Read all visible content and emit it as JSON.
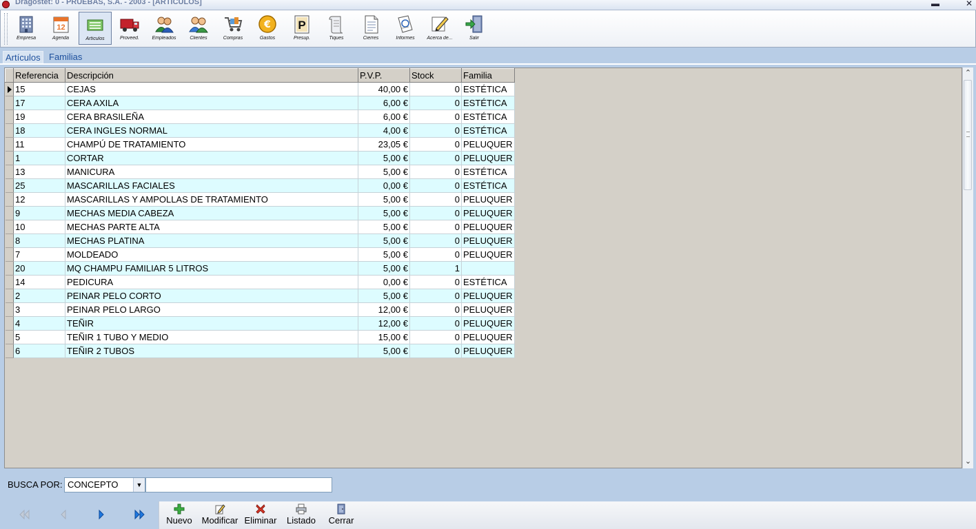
{
  "window": {
    "title": "Dragostet: 0 - PRUEBAS, S.A. - 2003 - [ARTICULOS]",
    "minimize_glyph": "▬",
    "close_glyph": "✕"
  },
  "toolbar": {
    "buttons": [
      {
        "label": "Empresa",
        "icon": "building-icon"
      },
      {
        "label": "Agenda",
        "icon": "calendar-icon",
        "calendar_day": "12"
      },
      {
        "label": "Artículos",
        "icon": "articles-icon",
        "active": true
      },
      {
        "label": "Proveed.",
        "icon": "truck-icon"
      },
      {
        "label": "Empleados",
        "icon": "employees-icon"
      },
      {
        "label": "Clientes",
        "icon": "clients-icon"
      },
      {
        "label": "Compras",
        "icon": "cart-icon"
      },
      {
        "label": "Gastos",
        "icon": "euro-coin-icon",
        "coin_glyph": "€"
      },
      {
        "label": "Presup.",
        "icon": "budget-icon",
        "badge_glyph": "P"
      },
      {
        "label": "Tiques",
        "icon": "receipt-icon"
      },
      {
        "label": "Cierres",
        "icon": "document-icon"
      },
      {
        "label": "Informes",
        "icon": "report-icon"
      },
      {
        "label": "Acerca de...",
        "icon": "pen-icon"
      },
      {
        "label": "Salir",
        "icon": "exit-door-icon"
      }
    ]
  },
  "tabs": [
    {
      "label": "Artículos",
      "active": true
    },
    {
      "label": "Familias",
      "active": false
    }
  ],
  "grid": {
    "columns": [
      "Referencia",
      "Descripción",
      "P.V.P.",
      "Stock",
      "Familia"
    ],
    "selected_row": 0,
    "rows": [
      {
        "ref": "15",
        "desc": "CEJAS",
        "pvp": "40,00 €",
        "stock": "0",
        "familia": "ESTÉTICA"
      },
      {
        "ref": "17",
        "desc": "CERA AXILA",
        "pvp": "6,00 €",
        "stock": "0",
        "familia": "ESTÉTICA"
      },
      {
        "ref": "19",
        "desc": "CERA BRASILEÑA",
        "pvp": "6,00 €",
        "stock": "0",
        "familia": "ESTÉTICA"
      },
      {
        "ref": "18",
        "desc": "CERA INGLES NORMAL",
        "pvp": "4,00 €",
        "stock": "0",
        "familia": "ESTÉTICA"
      },
      {
        "ref": "11",
        "desc": "CHAMPÚ DE TRATAMIENTO",
        "pvp": "23,05 €",
        "stock": "0",
        "familia": "PELUQUER"
      },
      {
        "ref": "1",
        "desc": "CORTAR",
        "pvp": "5,00 €",
        "stock": "0",
        "familia": "PELUQUER"
      },
      {
        "ref": "13",
        "desc": "MANICURA",
        "pvp": "5,00 €",
        "stock": "0",
        "familia": "ESTÉTICA"
      },
      {
        "ref": "25",
        "desc": "MASCARILLAS FACIALES",
        "pvp": "0,00 €",
        "stock": "0",
        "familia": "ESTÉTICA"
      },
      {
        "ref": "12",
        "desc": "MASCARILLAS Y AMPOLLAS DE TRATAMIENTO",
        "pvp": "5,00 €",
        "stock": "0",
        "familia": "PELUQUER"
      },
      {
        "ref": "9",
        "desc": "MECHAS MEDIA CABEZA",
        "pvp": "5,00 €",
        "stock": "0",
        "familia": "PELUQUER"
      },
      {
        "ref": "10",
        "desc": "MECHAS PARTE ALTA",
        "pvp": "5,00 €",
        "stock": "0",
        "familia": "PELUQUER"
      },
      {
        "ref": "8",
        "desc": "MECHAS PLATINA",
        "pvp": "5,00 €",
        "stock": "0",
        "familia": "PELUQUER"
      },
      {
        "ref": "7",
        "desc": "MOLDEADO",
        "pvp": "5,00 €",
        "stock": "0",
        "familia": "PELUQUER"
      },
      {
        "ref": "20",
        "desc": "MQ CHAMPU FAMILIAR 5 LITROS",
        "pvp": "5,00 €",
        "stock": "1",
        "familia": ""
      },
      {
        "ref": "14",
        "desc": "PEDICURA",
        "pvp": "0,00 €",
        "stock": "0",
        "familia": "ESTÉTICA"
      },
      {
        "ref": "2",
        "desc": "PEINAR PELO CORTO",
        "pvp": "5,00 €",
        "stock": "0",
        "familia": "PELUQUER"
      },
      {
        "ref": "3",
        "desc": "PEINAR PELO LARGO",
        "pvp": "12,00 €",
        "stock": "0",
        "familia": "PELUQUER"
      },
      {
        "ref": "4",
        "desc": "TEÑIR",
        "pvp": "12,00 €",
        "stock": "0",
        "familia": "PELUQUER"
      },
      {
        "ref": "5",
        "desc": "TEÑIR 1 TUBO Y MEDIO",
        "pvp": "15,00 €",
        "stock": "0",
        "familia": "PELUQUER"
      },
      {
        "ref": "6",
        "desc": "TEÑIR 2 TUBOS",
        "pvp": "5,00 €",
        "stock": "0",
        "familia": "PELUQUER"
      }
    ]
  },
  "scrollbar": {
    "up_glyph": "⌃",
    "down_glyph": "⌄"
  },
  "search": {
    "label": "BUSCA POR:",
    "field_value": "CONCEPTO",
    "dropdown_glyph": "▼",
    "query_value": ""
  },
  "navigation": {
    "buttons": [
      {
        "name": "first-record",
        "icon": "double-left-arrow-icon",
        "enabled": false
      },
      {
        "name": "previous-record",
        "icon": "left-arrow-icon",
        "enabled": false
      },
      {
        "name": "next-record",
        "icon": "right-arrow-icon",
        "enabled": true
      },
      {
        "name": "last-record",
        "icon": "double-right-arrow-icon",
        "enabled": true
      }
    ]
  },
  "actions": [
    {
      "label": "Nuevo",
      "icon": "plus-icon"
    },
    {
      "label": "Modificar",
      "icon": "edit-icon"
    },
    {
      "label": "Eliminar",
      "icon": "delete-icon"
    },
    {
      "label": "Listado",
      "icon": "print-icon"
    },
    {
      "label": "Cerrar",
      "icon": "close-door-icon"
    }
  ],
  "colors": {
    "row_odd": "#ffffff",
    "row_even": "#ddfcff",
    "grid_background": "#d4d0c8",
    "window_background": "#b8cde6",
    "tab_text": "#1d4f9c"
  }
}
